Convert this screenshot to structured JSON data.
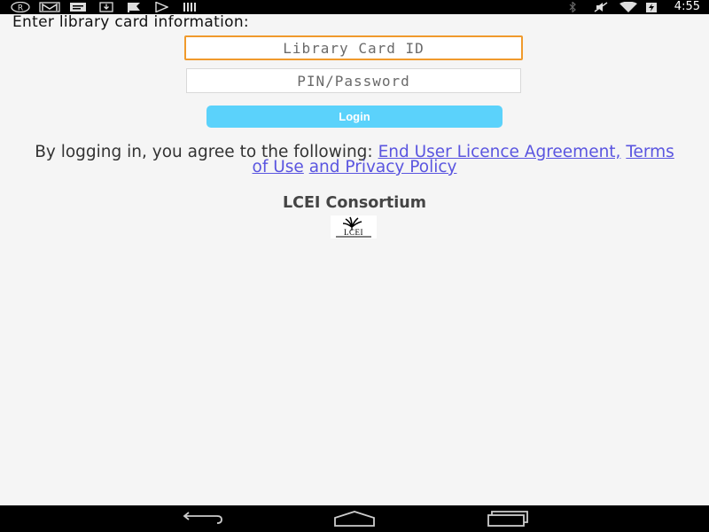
{
  "status_bar": {
    "time": "4:55",
    "left_icons": [
      "registered-icon",
      "gmail-icon",
      "message-icon",
      "download-icon",
      "flag-icon",
      "play-store-icon",
      "barcode-icon"
    ],
    "right_icons": [
      "bluetooth-icon",
      "mute-icon",
      "wifi-icon",
      "battery-charging-icon"
    ]
  },
  "login": {
    "heading": "Enter library card information:",
    "card_placeholder": "Library Card ID",
    "pin_placeholder": "PIN/Password",
    "button_label": "Login"
  },
  "agreement": {
    "prefix": "By logging in, you agree to the following:",
    "eula_link": "End User Licence Agreement,",
    "terms_link": "Terms of Use",
    "privacy_link": "and Privacy Policy"
  },
  "footer": {
    "consortium": "LCEI Consortium",
    "logo_text": "LCEI"
  },
  "nav_bar": {
    "buttons": [
      "back-icon",
      "home-icon",
      "recents-icon"
    ]
  },
  "colors": {
    "button": "#5bd2fb",
    "focus_border": "#f09a2c",
    "link": "#5a55e0"
  }
}
